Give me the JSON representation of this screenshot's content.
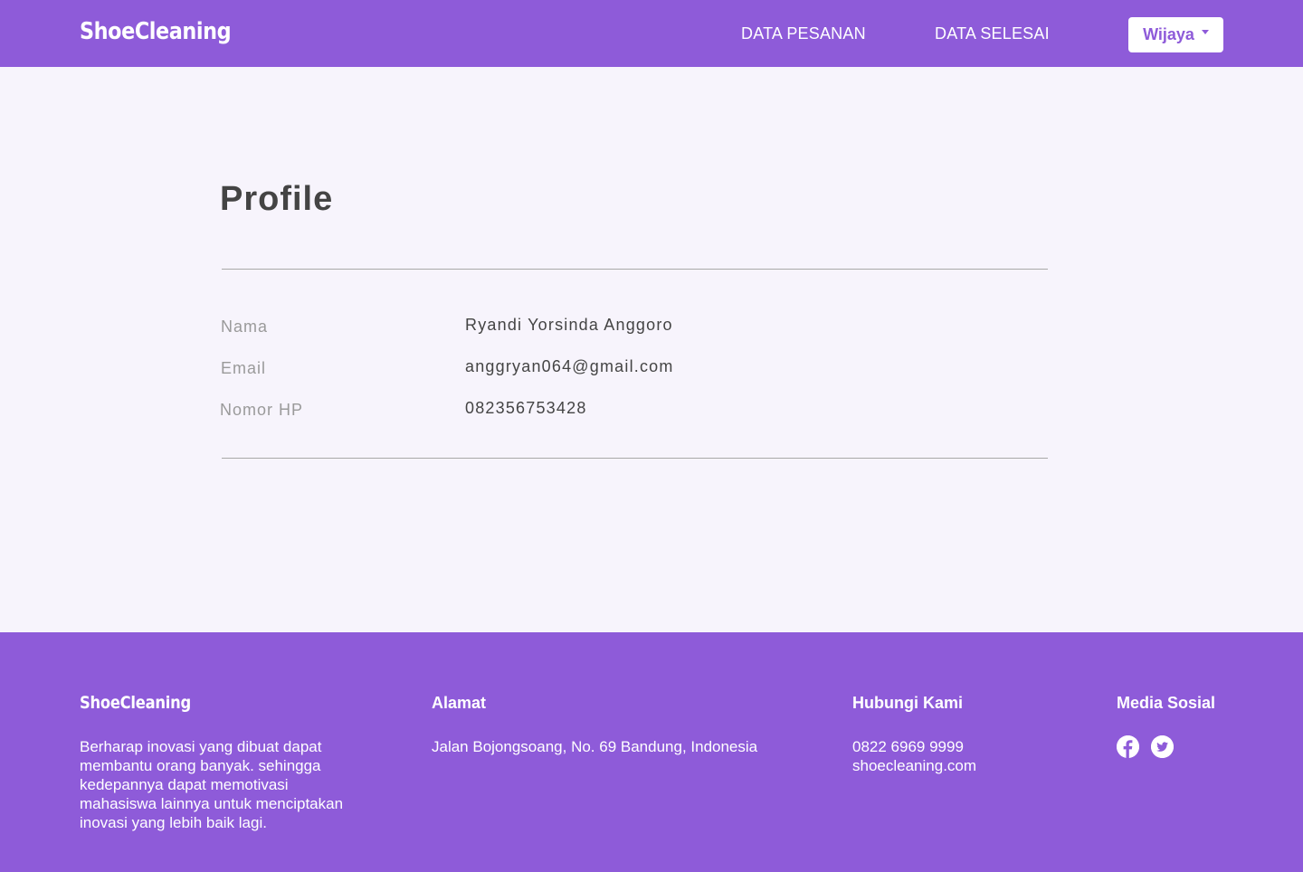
{
  "header": {
    "brand": "ShoeCleaning",
    "nav": [
      {
        "label": "DATA PESANAN"
      },
      {
        "label": "DATA SELESAI"
      }
    ],
    "user_menu": "Wijaya"
  },
  "profile": {
    "title": "Profile",
    "fields": [
      {
        "label": "Nama",
        "value": "Ryandi Yorsinda Anggoro"
      },
      {
        "label": "Email",
        "value": "anggryan064@gmail.com"
      },
      {
        "label": "Nomor HP",
        "value": "082356753428"
      }
    ]
  },
  "footer": {
    "brand": "ShoeCleaning",
    "about_lines": [
      "Berharap inovasi yang dibuat dapat",
      "membantu orang banyak. sehingga",
      "kedepannya dapat memotivasi",
      "mahasiswa lainnya untuk menciptakan",
      "inovasi yang lebih baik lagi."
    ],
    "alamat": {
      "heading": "Alamat",
      "text": "Jalan Bojongsoang, No. 69 Bandung, Indonesia"
    },
    "kontak": {
      "heading": "Hubungi Kami",
      "phone": "0822 6969 9999",
      "website": "shoecleaning.com"
    },
    "sosial": {
      "heading": "Media Sosial",
      "icons": [
        "facebook-icon",
        "twitter-icon"
      ]
    }
  },
  "colors": {
    "primary": "#8e5bd9",
    "background": "#f7f4fc",
    "text": "#444444",
    "muted": "#9a9a9a"
  }
}
